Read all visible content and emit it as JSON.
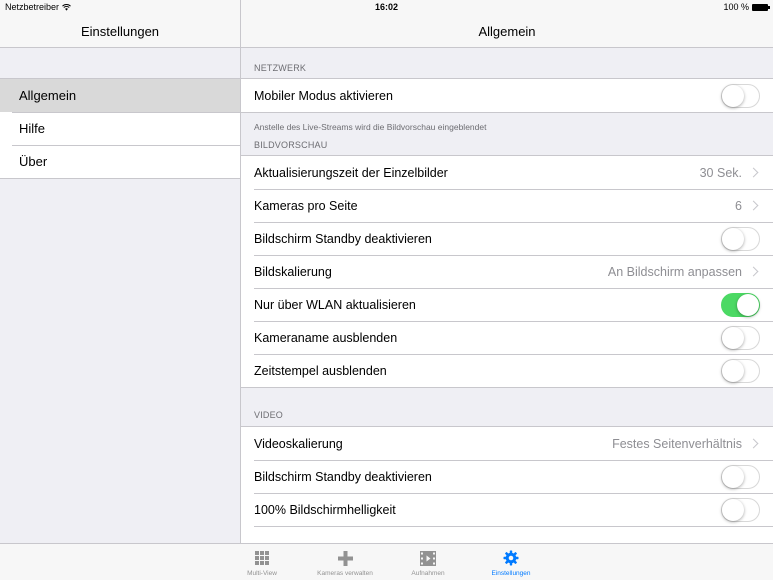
{
  "status_bar": {
    "carrier": "Netzbetreiber",
    "time": "16:02",
    "battery": "100 %"
  },
  "master": {
    "title": "Einstellungen",
    "items": [
      {
        "label": "Allgemein",
        "selected": true
      },
      {
        "label": "Hilfe",
        "selected": false
      },
      {
        "label": "Über",
        "selected": false
      }
    ]
  },
  "detail": {
    "title": "Allgemein",
    "sections": {
      "netzwerk": {
        "header": "NETZWERK",
        "rows": {
          "mobile_mode": {
            "label": "Mobiler Modus aktivieren",
            "on": false
          }
        },
        "footer": "Anstelle des Live-Streams wird die Bildvorschau eingeblendet"
      },
      "bildvorschau": {
        "header": "BILDVORSCHAU",
        "rows": {
          "refresh_time": {
            "label": "Aktualisierungszeit der Einzelbilder",
            "value": "30 Sek."
          },
          "cameras_per_page": {
            "label": "Kameras pro Seite",
            "value": "6"
          },
          "standby": {
            "label": "Bildschirm Standby deaktivieren",
            "on": false
          },
          "scaling": {
            "label": "Bildskalierung",
            "value": "An Bildschirm anpassen"
          },
          "wlan_only": {
            "label": "Nur über WLAN aktualisieren",
            "on": true
          },
          "hide_camera_name": {
            "label": "Kameraname ausblenden",
            "on": false
          },
          "hide_timestamp": {
            "label": "Zeitstempel ausblenden",
            "on": false
          }
        }
      },
      "video": {
        "header": "VIDEO",
        "rows": {
          "video_scaling": {
            "label": "Videoskalierung",
            "value": "Festes Seitenverhältnis"
          },
          "standby": {
            "label": "Bildschirm Standby deaktivieren",
            "on": false
          },
          "brightness": {
            "label": "100% Bildschirmhelligkeit",
            "on": false
          }
        }
      }
    }
  },
  "tab_bar": {
    "tabs": [
      {
        "label": "Multi-View",
        "icon": "grid-icon",
        "active": false
      },
      {
        "label": "Kameras verwalten",
        "icon": "plus-icon",
        "active": false
      },
      {
        "label": "Aufnahmen",
        "icon": "film-icon",
        "active": false
      },
      {
        "label": "Einstellungen",
        "icon": "gear-icon",
        "active": true
      }
    ]
  },
  "colors": {
    "accent": "#007aff",
    "toggle_on": "#4cd964",
    "background": "#efeff4"
  }
}
